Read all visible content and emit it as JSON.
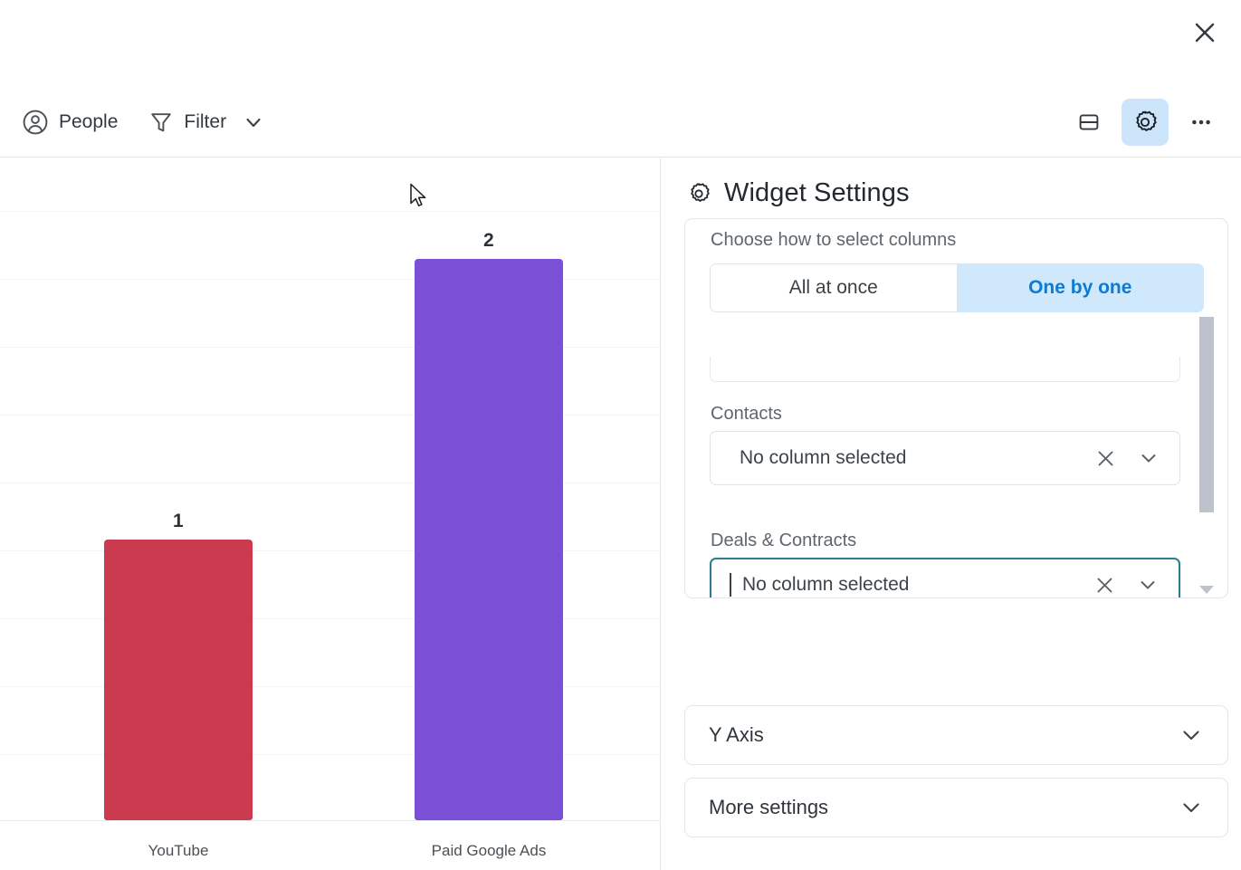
{
  "window": {
    "close_label": "Close"
  },
  "toolbar": {
    "items": [
      {
        "label": "People",
        "icon": "person-circle-icon"
      },
      {
        "label": "Filter",
        "icon": "funnel-icon",
        "has_chevron": true
      }
    ],
    "right_buttons": [
      {
        "name": "layout-split-button",
        "icon": "layout-split-icon",
        "active": false
      },
      {
        "name": "widget-settings-button",
        "icon": "gear-icon",
        "active": true
      },
      {
        "name": "more-options-button",
        "icon": "ellipsis-icon",
        "active": false
      }
    ],
    "accent_active_bg": "#cce5fb"
  },
  "chart_data": {
    "type": "bar",
    "categories": [
      "YouTube",
      "Paid Google Ads"
    ],
    "values": [
      1,
      2
    ],
    "value_labels": [
      "1",
      "2"
    ],
    "colors": [
      "#cb3a4f",
      "#7950d6"
    ],
    "title": "",
    "xlabel": "",
    "ylabel": "",
    "ylim": [
      0,
      2.35
    ],
    "grid": true,
    "gridlines": 9,
    "legend": "none",
    "data_labels": true
  },
  "settings": {
    "title": "Widget Settings",
    "title_icon": "gear-icon",
    "columns_section": {
      "prompt": "Choose how to select columns",
      "modes": [
        {
          "label": "All at once",
          "selected": false
        },
        {
          "label": "One by one",
          "selected": true
        }
      ],
      "fields": [
        {
          "label": "Contacts",
          "value": "No column selected",
          "focused": false,
          "clear_icon": "close-icon",
          "expand_icon": "chevron-down-icon"
        },
        {
          "label": "Deals & Contracts",
          "value": "No column selected",
          "focused": true,
          "clear_icon": "close-icon",
          "expand_icon": "chevron-down-icon"
        }
      ]
    },
    "collapsible_rows": [
      {
        "label": "Y Axis",
        "icon": "chevron-down-icon"
      },
      {
        "label": "More settings",
        "icon": "chevron-down-icon"
      }
    ]
  },
  "colors": {
    "selected_segment_bg": "#cfe8fb",
    "selected_segment_text": "#0d7ad4",
    "focus_border": "#2d7d8f",
    "bar_red": "#cb3a4f",
    "bar_purple": "#7950d6"
  }
}
